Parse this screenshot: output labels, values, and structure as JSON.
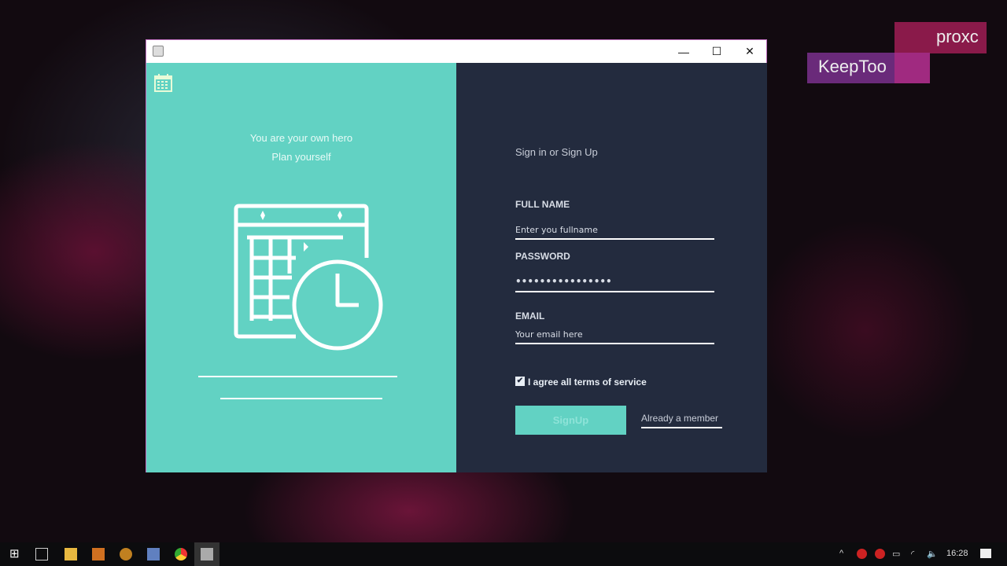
{
  "watermark": {
    "top": "proxc",
    "bottom": "KeepToo"
  },
  "window": {
    "controls": {
      "minimize": "—",
      "maximize": "☐",
      "close": "✕"
    }
  },
  "left": {
    "tagline1": "You are your own hero",
    "tagline2": "Plan yourself"
  },
  "right": {
    "heading": "Sign in or Sign Up",
    "fullname": {
      "label": "FULL NAME",
      "placeholder": "Enter you fullname"
    },
    "password": {
      "label": "PASSWORD",
      "value": "••••••••••••••••"
    },
    "email": {
      "label": "EMAIL",
      "placeholder": "Your email here"
    },
    "terms": {
      "label": "I agree all terms of service",
      "checked": true
    },
    "signup": "SignUp",
    "member": "Already a member"
  },
  "colors": {
    "teal": "#62d2c3",
    "navy": "#232b3e"
  },
  "taskbar": {
    "clock": "16:28"
  }
}
